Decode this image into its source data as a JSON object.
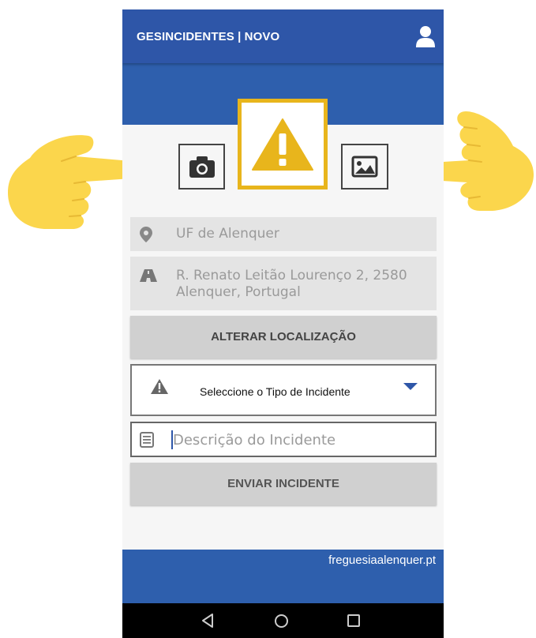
{
  "app": {
    "title": "GESINCIDENTES | NOVO"
  },
  "actions": {
    "photo": "camera-icon",
    "gallery": "image-icon",
    "main": "warning-icon"
  },
  "location": {
    "entity": "UF de Alenquer",
    "address": "R. Renato Leitão Lourenço 2, 2580 Alenquer, Portugal",
    "change_button": "ALTERAR LOCALIZAÇÃO"
  },
  "incident": {
    "type_placeholder": "Seleccione o Tipo de Incidente",
    "description_placeholder": "Descrição do Incidente",
    "send_button": "ENVIAR INCIDENTE"
  },
  "footer": {
    "link": "freguesiaalenquer.pt"
  },
  "colors": {
    "primary": "#2e56a8",
    "accent": "#e8b51c",
    "pointer": "#fbd64c"
  }
}
